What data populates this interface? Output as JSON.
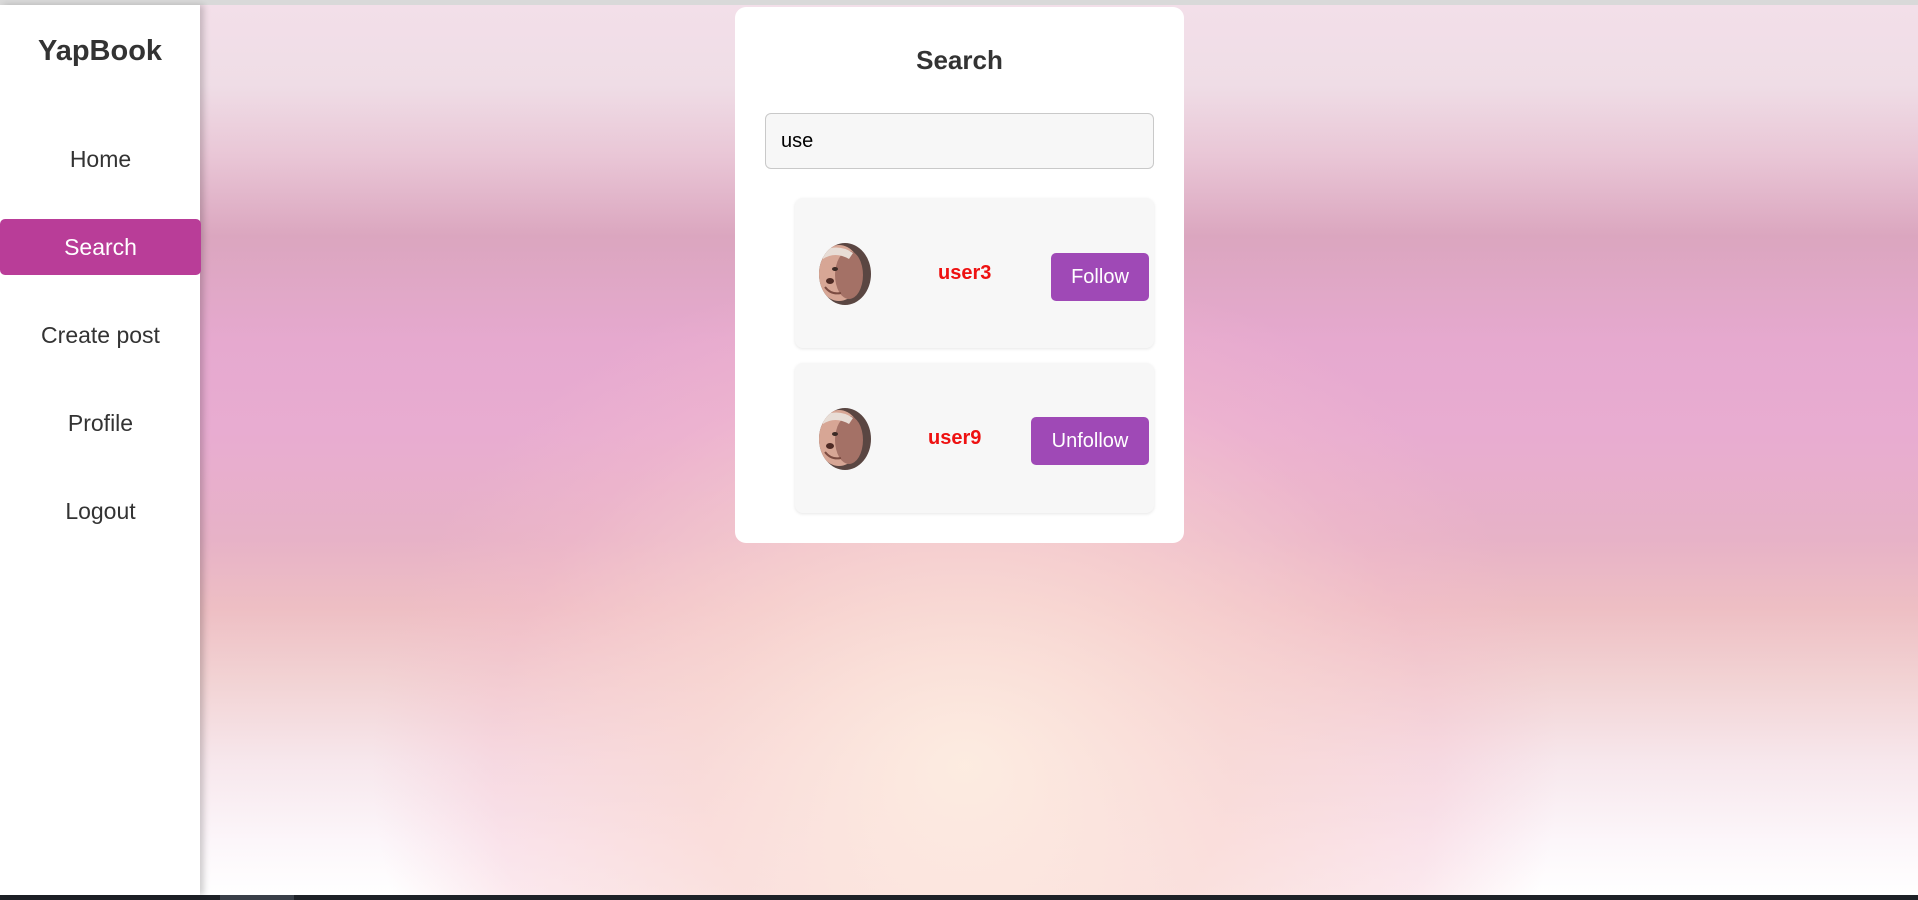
{
  "sidebar": {
    "brand": "YapBook",
    "items": [
      {
        "label": "Home",
        "active": false
      },
      {
        "label": "Search",
        "active": true
      },
      {
        "label": "Create post",
        "active": false
      },
      {
        "label": "Profile",
        "active": false
      },
      {
        "label": "Logout",
        "active": false
      }
    ]
  },
  "search": {
    "title": "Search",
    "query": "use",
    "results": [
      {
        "username": "user3",
        "action": "Follow",
        "avatar": "user-avatar-photo"
      },
      {
        "username": "user9",
        "action": "Unfollow",
        "avatar": "user-avatar-photo"
      }
    ]
  },
  "colors": {
    "accent_active_nav": "#b93d98",
    "button": "#9f49b6",
    "username": "#ee1111"
  }
}
